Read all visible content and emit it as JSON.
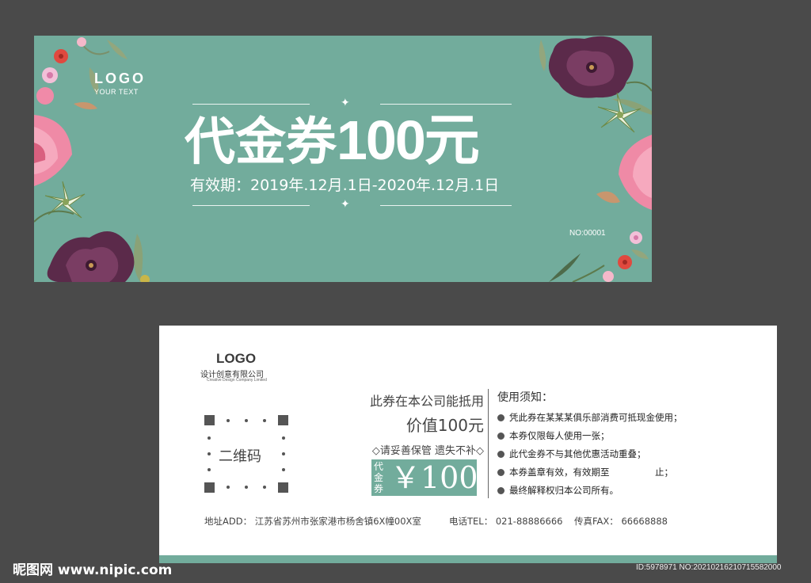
{
  "front": {
    "logo": "LOGO",
    "logo_sub": "YOUR TEXT",
    "title": "代金券",
    "amount": "100元",
    "validity": "有效期：2019年.12月.1日-2020年.12月.1日",
    "serial": "NO:00001",
    "background_color": "#72ac9c"
  },
  "back": {
    "logo": "LOGO",
    "company": "设计创意有限公司",
    "company_en": "Creative Design Company Limited",
    "qr_label": "二维码",
    "line1": "此券在本公司能抵用",
    "line2": "价值100元",
    "line3": "◇请妥善保管 遗失不补◇",
    "coupon_vertical_label": "代金券",
    "coupon_amount": "￥100",
    "rules_title": "使用须知：",
    "rules": [
      "凭此券在某某某俱乐部消费可抵现金使用；",
      "本券仅限每人使用一张；",
      "此代金券不与其他优惠活动重叠；",
      "本券盖章有效，有效期至　　　　　止；",
      "最终解释权归本公司所有。"
    ],
    "address": "地址ADD： 江苏省苏州市张家港市杨舍镇6X幢00X室",
    "phone": "电话TEL： 021-88886666",
    "fax": "传真FAX： 66668888"
  },
  "watermark": {
    "site": "昵图网 www.nipic.com",
    "id": "ID:5978971 NO:20210216210715582000"
  }
}
